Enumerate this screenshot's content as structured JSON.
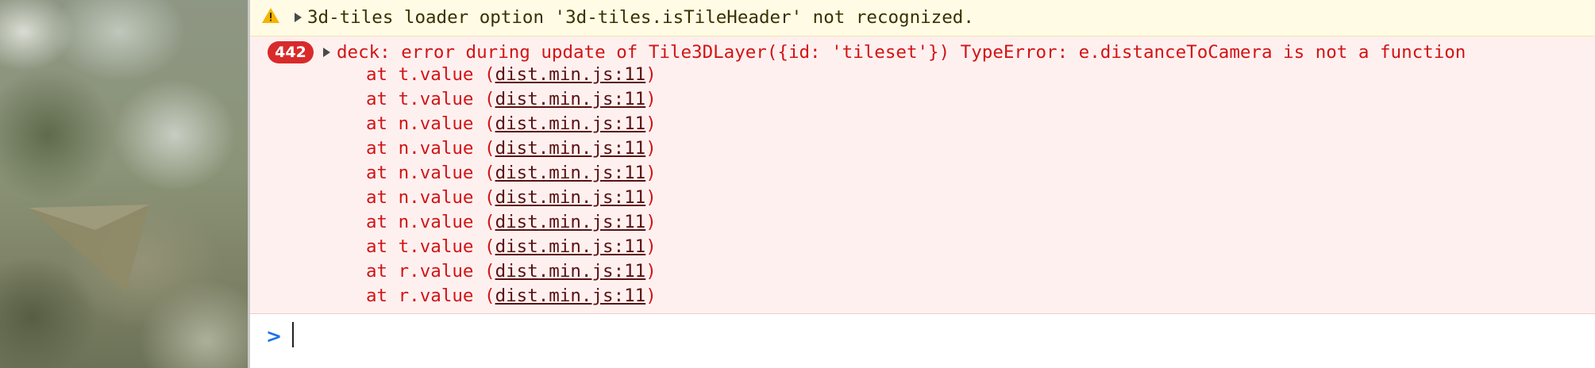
{
  "console": {
    "warning": {
      "text": "3d-tiles loader option '3d-tiles.isTileHeader' not recognized."
    },
    "error": {
      "count": "442",
      "message": "deck: error during update of Tile3DLayer({id: 'tileset'}) TypeError: e.distanceToCamera is not a function",
      "stack": [
        {
          "prefix": "at t.value (",
          "link": "dist.min.js:11",
          "suffix": ")"
        },
        {
          "prefix": "at t.value (",
          "link": "dist.min.js:11",
          "suffix": ")"
        },
        {
          "prefix": "at n.value (",
          "link": "dist.min.js:11",
          "suffix": ")"
        },
        {
          "prefix": "at n.value (",
          "link": "dist.min.js:11",
          "suffix": ")"
        },
        {
          "prefix": "at n.value (",
          "link": "dist.min.js:11",
          "suffix": ")"
        },
        {
          "prefix": "at n.value (",
          "link": "dist.min.js:11",
          "suffix": ")"
        },
        {
          "prefix": "at n.value (",
          "link": "dist.min.js:11",
          "suffix": ")"
        },
        {
          "prefix": "at t.value (",
          "link": "dist.min.js:11",
          "suffix": ")"
        },
        {
          "prefix": "at r.value (",
          "link": "dist.min.js:11",
          "suffix": ")"
        },
        {
          "prefix": "at r.value (",
          "link": "dist.min.js:11",
          "suffix": ")"
        }
      ]
    },
    "prompt": {
      "symbol": ">"
    }
  },
  "icons": {
    "warning": "warning-triangle-icon",
    "expand": "expand-triangle-icon",
    "prompt": "prompt-chevron-icon"
  },
  "colors": {
    "warning_bg": "#fffbe5",
    "error_bg": "#fff0f0",
    "error_text": "#d21414",
    "badge_bg": "#d92a2a",
    "prompt_accent": "#1a73e8"
  }
}
